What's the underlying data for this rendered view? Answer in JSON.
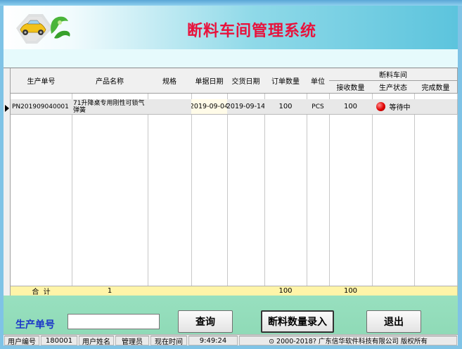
{
  "window": {
    "title": "断料车间管理系统"
  },
  "grid": {
    "headers": {
      "order_no": "生产单号",
      "product_name": "产品名称",
      "spec": "规格",
      "doc_date": "单据日期",
      "delivery_date": "交货日期",
      "order_qty": "订单数量",
      "unit": "单位",
      "workshop_group": "断料车间",
      "received_qty": "接收数量",
      "prod_status": "生产状态",
      "done_qty": "完成数量"
    },
    "rows": [
      {
        "order_no": "PN201909040001",
        "product_name": "71升降桌专用刚性可锁气弹簧",
        "spec": "",
        "doc_date": "2019-09-04",
        "delivery_date": "2019-09-14",
        "order_qty": "100",
        "unit": "PCS",
        "received_qty": "100",
        "prod_status": "等待中",
        "done_qty": ""
      }
    ],
    "totals": {
      "label": "合  计",
      "count": "1",
      "order_qty": "100",
      "received_qty": "100"
    }
  },
  "search": {
    "label": "生产单号",
    "value": "",
    "query_button": "查询",
    "entry_button": "断料数量录入",
    "exit_button": "退出"
  },
  "statusbar": {
    "user_no_label": "用户编号",
    "user_no": "180001",
    "user_name_label": "用户姓名",
    "user_name": "管理员",
    "time_label": "现在时间",
    "time": "9:49:24",
    "copyright": "⊙ 2000-2018?  广东信华软件科技有限公司  版权所有"
  },
  "colors": {
    "title": "#e8123c",
    "label_blue": "#1a35c9",
    "totals_bg": "#fff4a8",
    "bottom_panel": "#8fdab7"
  }
}
